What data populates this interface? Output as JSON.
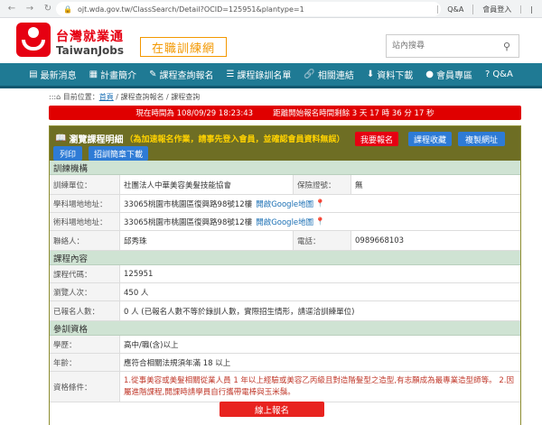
{
  "browser": {
    "nav_back": "←",
    "nav_forward": "→",
    "nav_reload": "↻",
    "url": "ojt.wda.gov.tw/ClassSearch/Detail?OCID=125951&plantype=1",
    "top_links": [
      "Q&A",
      "會員登入",
      "|"
    ]
  },
  "header": {
    "logo_zh": "台灣就業通",
    "logo_en": "TaiwanJobs",
    "banner": "在職訓練網",
    "search_placeholder": "站內搜尋"
  },
  "menu": [
    {
      "icon": "newspaper-icon",
      "glyph": "▤",
      "label": "最新消息"
    },
    {
      "icon": "calculator-icon",
      "glyph": "▦",
      "label": "計畫簡介"
    },
    {
      "icon": "pencil-icon",
      "glyph": "✎",
      "label": "課程查詢報名"
    },
    {
      "icon": "list-icon",
      "glyph": "☰",
      "label": "課程錄訓名單"
    },
    {
      "icon": "link-icon",
      "glyph": "🔗",
      "label": "相關連結"
    },
    {
      "icon": "download-icon",
      "glyph": "⬇",
      "label": "資料下載"
    },
    {
      "icon": "user-icon",
      "glyph": "●",
      "label": "會員專區"
    },
    {
      "icon": "question-icon",
      "glyph": "?",
      "label": "Q&A"
    }
  ],
  "breadcrumb": {
    "prefix": ":::",
    "location": "目前位置：",
    "home": "首頁",
    "sep1": " / ",
    "level1": "課程查詢報名",
    "sep2": " / ",
    "level2": "課程查詢"
  },
  "countdown": {
    "now_label": "現在時間為 108/09/29 18:23:43",
    "remain_label": "距離開始報名時間剩餘 3 天 17 時 36 分 17 秒"
  },
  "panel": {
    "title": "瀏覽課程明細",
    "note": "（為加速報名作業，請事先登入會員，並確認會員資料無誤）",
    "buttons": {
      "signup": "我要報名",
      "collect": "課程收藏",
      "copy": "複製網址",
      "print": "列印",
      "brochure": "招訓簡章下載"
    }
  },
  "sections": {
    "org": {
      "title": "訓練機構",
      "unit_label": "訓練單位：",
      "unit_value": "社團法人中華美容美髮技能協會",
      "insurance_label": "保險證號：",
      "insurance_value": "無",
      "class_addr_label": "學科場地地址：",
      "class_addr_value": "33065桃園市桃園區復興路98號12樓",
      "tech_addr_label": "術科場地地址：",
      "tech_addr_value": "33065桃園市桃園區復興路98號12樓",
      "map_link": "開啟Google地圖",
      "contact_label": "聯絡人：",
      "contact_value": "邱秀珠",
      "phone_label": "電話：",
      "phone_value": "0989668103"
    },
    "course": {
      "title": "課程內容",
      "code_label": "課程代碼：",
      "code_value": "125951",
      "views_label": "瀏覽人次：",
      "views_value": "450 人",
      "registered_label": "已報名人數：",
      "registered_value": "0 人 (已報名人數不等於錄訓人數，實際招生情形，請逕洽訓練單位)"
    },
    "qual": {
      "title": "參訓資格",
      "edu_label": "學歷：",
      "edu_value": "高中/職(含)以上",
      "age_label": "年齡：",
      "age_value": "應符合相關法規須年滿 18 以上",
      "cond_label": "資格條件：",
      "cond_value": "1.從事美容或美髮相關從業人員 1 年以上經驗或美容乙丙級且對造階髮型之造型,有志願成為最專業造型師等。 2.因屬進階課程,開課時請學員自行攜帶電棒與玉米鬚。"
    }
  },
  "signup_button": "線上報名",
  "colors": {
    "menu_bg": "#1f7a94",
    "brand_red": "#e60012",
    "panel_head": "#6e6e24",
    "section_bg": "#cfe3d3"
  }
}
